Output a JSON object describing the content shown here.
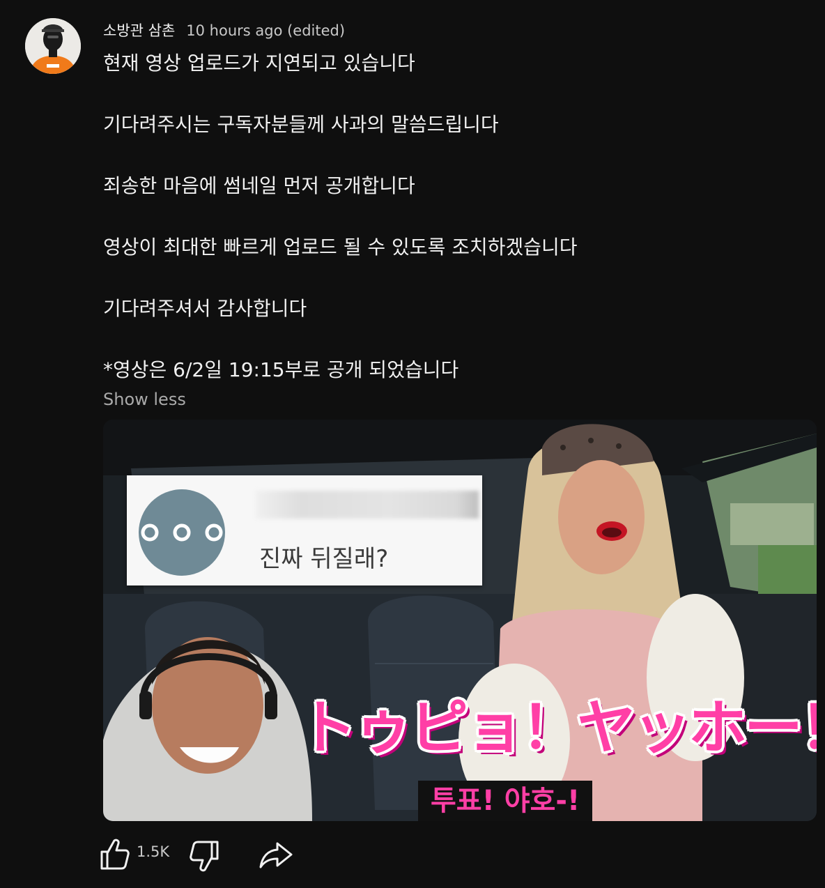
{
  "author": {
    "name": "소방관 삼촌",
    "timestamp": "10 hours ago (edited)"
  },
  "post": {
    "lines": [
      "현재 영상 업로드가 지연되고 있습니다",
      "기다려주시는 구독자분들께 사과의 말씀드립니다",
      "죄송한 마음에 썸네일 먼저 공개합니다",
      "영상이 최대한 빠르게 업로드 될 수 있도록 조치하겠습니다",
      "기다려주셔서 감사합니다",
      "*영상은 6/2일 19:15부로 공개 되었습니다"
    ],
    "show_less": "Show less"
  },
  "thumbnail": {
    "comment_text": "진짜 뒤질래?",
    "caption_jp": "トゥピョ！ヤッホー！",
    "caption_kr": "투표! 야호-!"
  },
  "actions": {
    "like_count": "1.5K"
  },
  "icons": {
    "like": "thumbs-up-icon",
    "dislike": "thumbs-down-icon",
    "share": "share-icon"
  },
  "colors": {
    "background": "#0f0f0f",
    "text": "#f1f1f1",
    "secondary_text": "#aaaaaa",
    "caption_pink": "#ff3fa6"
  }
}
